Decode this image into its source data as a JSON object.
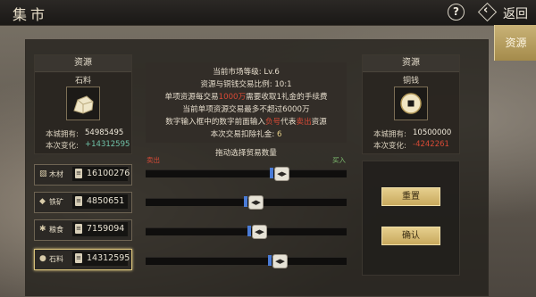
{
  "header": {
    "title": "集市",
    "help_label": "?",
    "back_label": "返回"
  },
  "side_tab": {
    "label": "资源"
  },
  "left_card": {
    "header": "资源",
    "item_name": "石料",
    "owned_label": "本城拥有:",
    "owned_value": "54985495",
    "change_label": "本次变化:",
    "change_value": "+14312595"
  },
  "right_card": {
    "header": "资源",
    "item_name": "铜钱",
    "owned_label": "本城拥有:",
    "owned_value": "10500000",
    "change_label": "本次变化:",
    "change_value": "-4242261"
  },
  "info": {
    "line1": "当前市场等级: Lv.6",
    "line2": "资源与铜钱交易比例: 10:1",
    "line3_a": "单项资源每交易",
    "line3_b": "1000万",
    "line3_c": "需要收取1礼金的手续费",
    "line4": "当前单项资源交易最多不超过6000万",
    "line5_a": "数字输入框中的数字前面输入",
    "line5_b": "负号",
    "line5_c": "代表",
    "line5_d": "卖出",
    "line5_e": "资源",
    "line6_a": "本次交易扣除礼金:",
    "line6_b": "6"
  },
  "slider_header": {
    "title": "拖动选择贸易数量",
    "sell_label": "卖出",
    "buy_label": "买入"
  },
  "resources": [
    {
      "name": "木材",
      "icon": "log-icon",
      "value": "16100276",
      "slider_fraction": 0.67
    },
    {
      "name": "铁矿",
      "icon": "ore-icon",
      "value": "4850651",
      "slider_fraction": 0.54
    },
    {
      "name": "粮食",
      "icon": "grain-icon",
      "value": "7159094",
      "slider_fraction": 0.56
    },
    {
      "name": "石料",
      "icon": "stone-icon",
      "value": "14312595",
      "slider_fraction": 0.66
    }
  ],
  "actions": {
    "reset_label": "重置",
    "confirm_label": "确认"
  },
  "colors": {
    "accent_gold": "#e8d28a",
    "sell_red": "#d84a36",
    "buy_green": "#7dbb6e",
    "change_positive": "#6fc2a8",
    "change_negative": "#d84a36"
  }
}
